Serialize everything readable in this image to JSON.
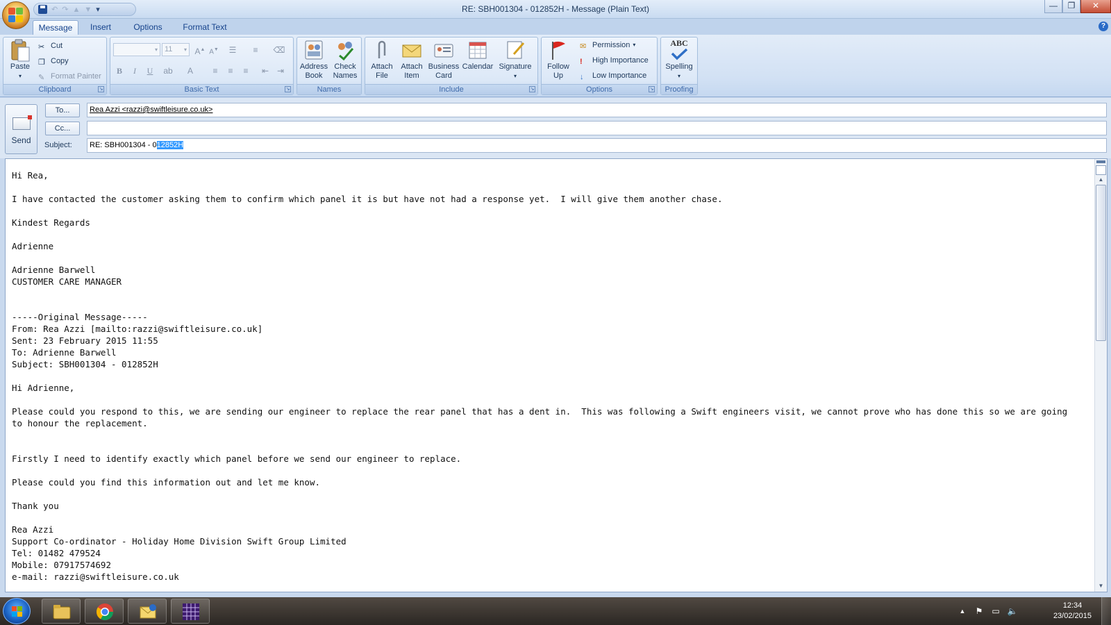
{
  "window": {
    "title": "RE: SBH001304 - 012852H - Message (Plain Text)",
    "minimize_glyph": "—",
    "restore_glyph": "❐",
    "close_glyph": "✕"
  },
  "tabs": [
    {
      "label": "Message",
      "active": true
    },
    {
      "label": "Insert",
      "active": false
    },
    {
      "label": "Options",
      "active": false
    },
    {
      "label": "Format Text",
      "active": false
    }
  ],
  "ribbon": {
    "clipboard": {
      "label": "Clipboard",
      "paste": "Paste",
      "cut": "Cut",
      "copy": "Copy",
      "format_painter": "Format Painter"
    },
    "basic_text": {
      "label": "Basic Text",
      "font_name": "",
      "font_size": "11",
      "bold": "B",
      "italic": "I",
      "underline": "U"
    },
    "names": {
      "label": "Names",
      "address_book": [
        "Address",
        "Book"
      ],
      "check_names": [
        "Check",
        "Names"
      ]
    },
    "include": {
      "label": "Include",
      "attach_file": [
        "Attach",
        "File"
      ],
      "attach_item": [
        "Attach",
        "Item"
      ],
      "business_card": [
        "Business",
        "Card"
      ],
      "calendar": "Calendar",
      "signature": "Signature"
    },
    "options": {
      "label": "Options",
      "follow_up": [
        "Follow",
        "Up"
      ],
      "permission": "Permission",
      "high_importance": "High Importance",
      "low_importance": "Low Importance"
    },
    "proofing": {
      "label": "Proofing",
      "spelling": "Spelling",
      "abc": "ABC"
    }
  },
  "header": {
    "send": "Send",
    "to_button": "To...",
    "cc_button": "Cc...",
    "subject_label": "Subject:",
    "to_value": "Rea Azzi <razzi@swiftleisure.co.uk>",
    "cc_value": "",
    "subject_prefix": "RE: SBH001304 - 0",
    "subject_selected": "12852H"
  },
  "body": {
    "text": "Hi Rea,\n\nI have contacted the customer asking them to confirm which panel it is but have not had a response yet.  I will give them another chase.\n\nKindest Regards\n\nAdrienne\n\nAdrienne Barwell\nCUSTOMER CARE MANAGER\n\n\n-----Original Message-----\nFrom: Rea Azzi [mailto:razzi@swiftleisure.co.uk]\nSent: 23 February 2015 11:55\nTo: Adrienne Barwell\nSubject: SBH001304 - 012852H\n\nHi Adrienne,\n\nPlease could you respond to this, we are sending our engineer to replace the rear panel that has a dent in.  This was following a Swift engineers visit, we cannot prove who has done this so we are going to honour the replacement.\n\n\nFirstly I need to identify exactly which panel before we send our engineer to replace.\n\nPlease could you find this information out and let me know.\n\nThank you\n\nRea Azzi\nSupport Co-ordinator - Holiday Home Division Swift Group Limited\nTel: 01482 479524\nMobile: 07917574692\ne-mail: razzi@swiftleisure.co.uk"
  },
  "taskbar": {
    "apps": [
      "windows-explorer-icon",
      "chrome-icon",
      "outlook-icon",
      "calendar-app-icon"
    ],
    "time": "12:34",
    "date": "23/02/2015"
  },
  "colors": {
    "ribbon_bg": "#d2e1f4",
    "accent_blue": "#15428b",
    "selection": "#3399ff",
    "close_button": "#c44d34"
  }
}
